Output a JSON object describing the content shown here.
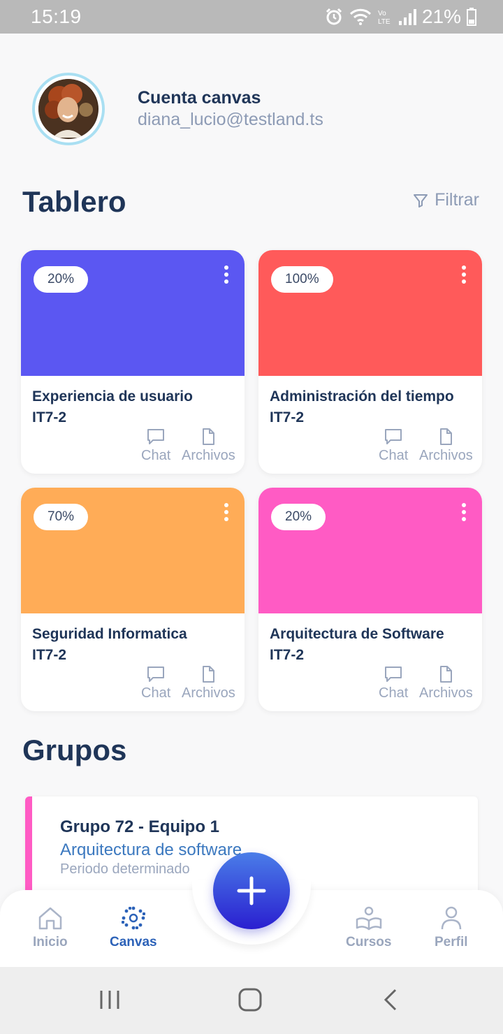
{
  "status_bar": {
    "time": "15:19",
    "battery": "21%",
    "icons": [
      "alarm-icon",
      "wifi-icon",
      "volte-icon",
      "signal-icon",
      "battery-icon"
    ]
  },
  "account": {
    "title": "Cuenta canvas",
    "email": "diana_lucio@testland.ts"
  },
  "dashboard": {
    "title": "Tablero",
    "filter_label": "Filtrar",
    "cards": [
      {
        "percent": "20%",
        "name": "Experiencia de usuario",
        "code": "IT7-2",
        "color": "#5b57f2",
        "progress": 0.2,
        "chat_label": "Chat",
        "files_label": "Archivos"
      },
      {
        "percent": "100%",
        "name": "Administración del tiempo",
        "code": "IT7-2",
        "color": "#ff5a5a",
        "progress": 1.0,
        "chat_label": "Chat",
        "files_label": "Archivos"
      },
      {
        "percent": "70%",
        "name": "Seguridad Informatica",
        "code": "IT7-2",
        "color": "#ffac57",
        "progress": 0.7,
        "chat_label": "Chat",
        "files_label": "Archivos"
      },
      {
        "percent": "20%",
        "name": "Arquitectura de Software",
        "code": "IT7-2",
        "color": "#ff5bc4",
        "progress": 0.2,
        "chat_label": "Chat",
        "files_label": "Archivos"
      }
    ]
  },
  "groups": {
    "title": "Grupos",
    "items": [
      {
        "name": "Grupo 72 - Equipo 1",
        "course": "Arquitectura de software",
        "period": "Periodo determinado",
        "accent": "#ff5bc4"
      }
    ]
  },
  "bottom_nav": {
    "items": [
      {
        "label": "Inicio",
        "icon": "home-icon",
        "active": false
      },
      {
        "label": "Canvas",
        "icon": "canvas-icon",
        "active": true
      },
      {
        "label": "Cursos",
        "icon": "courses-icon",
        "active": false
      },
      {
        "label": "Perfil",
        "icon": "profile-icon",
        "active": false
      }
    ],
    "fab_icon": "plus-icon"
  },
  "colors": {
    "primary_text": "#1f3558",
    "muted": "#9aa6bd",
    "accent_blue": "#2c62b8"
  }
}
